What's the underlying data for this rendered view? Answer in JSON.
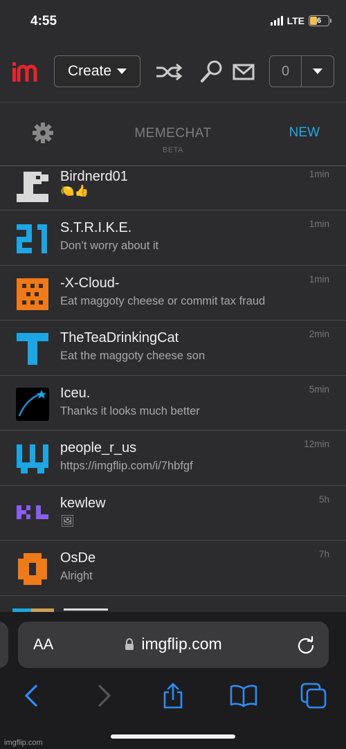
{
  "status": {
    "time": "4:55",
    "network": "LTE",
    "battery": "6"
  },
  "header": {
    "create_label": "Create",
    "notification_count": "0"
  },
  "memechat": {
    "title": "MEMECHAT",
    "beta": "BETA",
    "new_label": "NEW"
  },
  "chats": [
    {
      "name": "Birdnerd01",
      "message": "🍋👍",
      "time": "1min",
      "avatar": "blocky-gray-avatar"
    },
    {
      "name": "S.T.R.I.K.E.",
      "message": "Don’t worry about it",
      "time": "1min",
      "avatar": "blue-21-avatar"
    },
    {
      "name": "-X-Cloud-",
      "message": "Eat maggoty cheese or commit tax fraud",
      "time": "1min",
      "avatar": "orange-checker-avatar"
    },
    {
      "name": "TheTeaDrinkingCat",
      "message": "Eat the maggoty cheese son",
      "time": "2min",
      "avatar": "blue-t-avatar"
    },
    {
      "name": "Iceu.",
      "message": "Thanks it looks much better",
      "time": "5min",
      "avatar": "shooting-star-avatar"
    },
    {
      "name": "people_r_us",
      "message": "https://imgflip.com/i/7hbfgf",
      "time": "12min",
      "avatar": "blue-w-avatar"
    },
    {
      "name": "kewlew",
      "message": "🖼",
      "time": "5h",
      "avatar": "purple-kl-avatar"
    },
    {
      "name": "OsDe",
      "message": "Alright",
      "time": "7h",
      "avatar": "orange-block-avatar"
    }
  ],
  "browser": {
    "aa_label": "AA",
    "url": "imgflip.com"
  },
  "watermark": "imgflip.com",
  "colors": {
    "accent": "#1fa9e5",
    "brand_red": "#e8242d",
    "background": "#2c2c2e"
  }
}
